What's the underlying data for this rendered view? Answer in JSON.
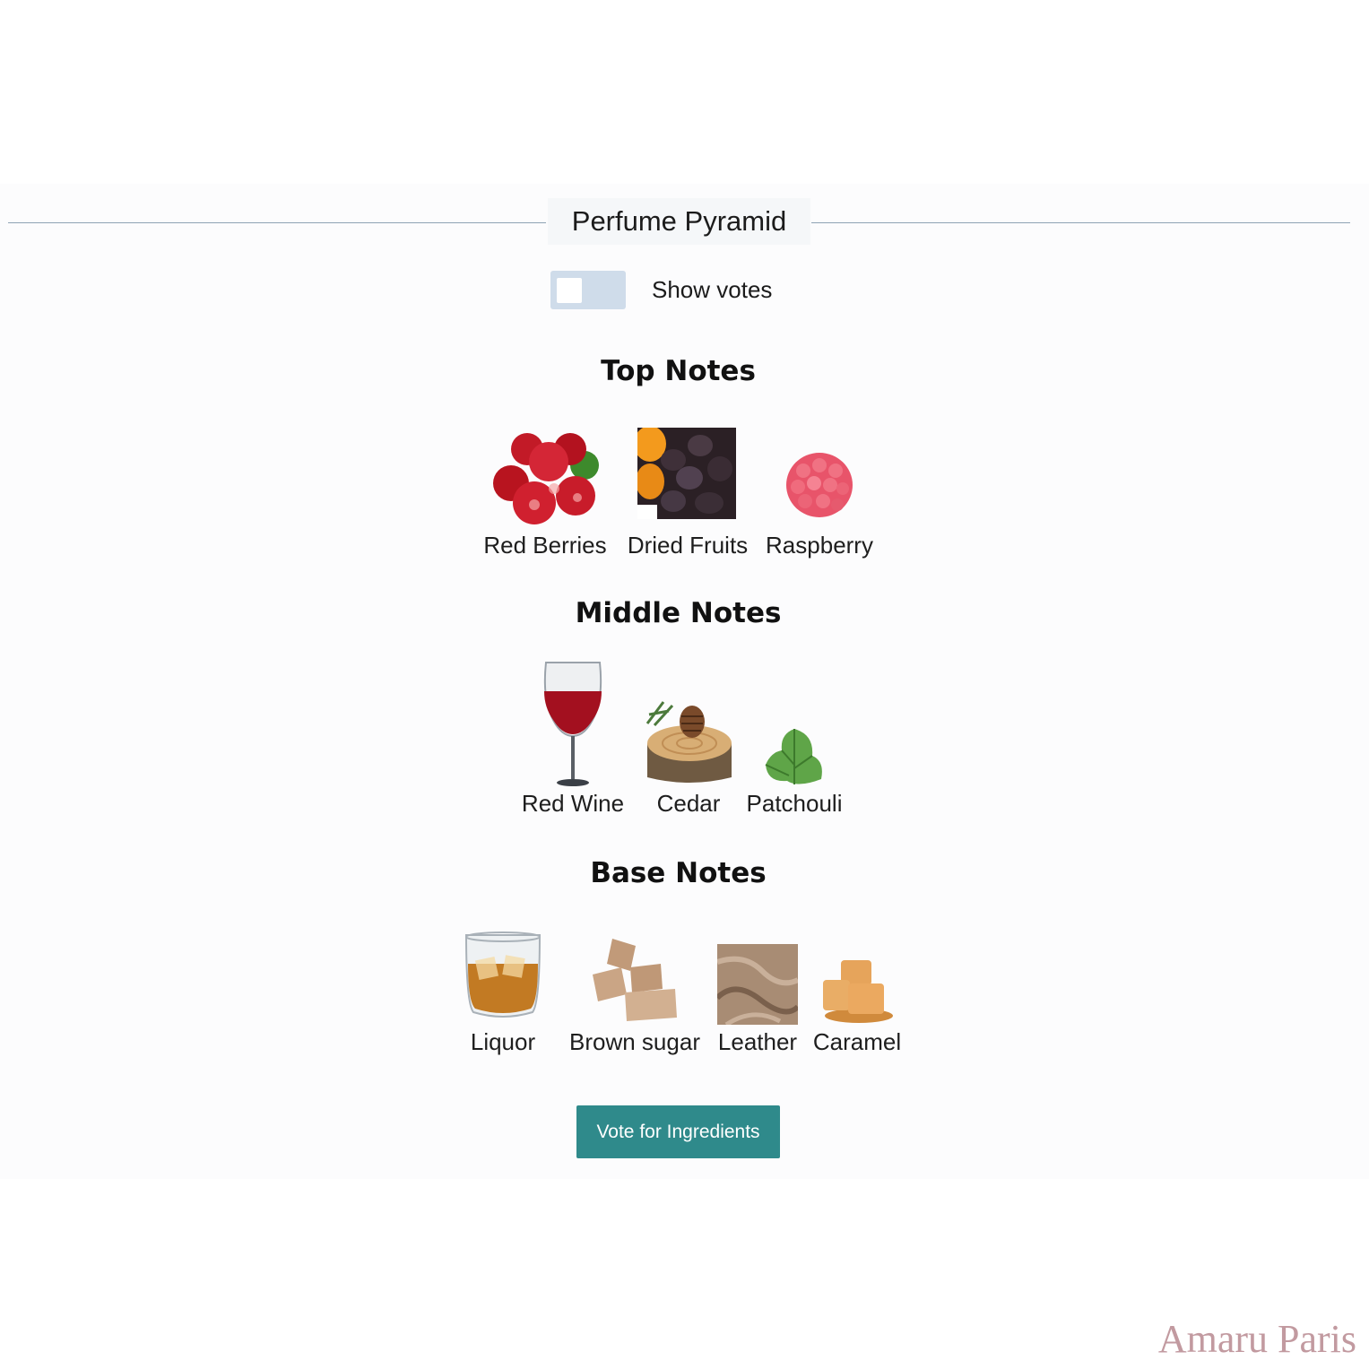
{
  "title": "Perfume Pyramid",
  "toggle": {
    "label": "Show votes",
    "on": false
  },
  "sections": {
    "top": {
      "title": "Top Notes",
      "notes": [
        {
          "label": "Red Berries",
          "icon": "red-berries-icon"
        },
        {
          "label": "Dried Fruits",
          "icon": "dried-fruits-icon"
        },
        {
          "label": "Raspberry",
          "icon": "raspberry-icon"
        }
      ]
    },
    "middle": {
      "title": "Middle Notes",
      "notes": [
        {
          "label": "Red Wine",
          "icon": "red-wine-icon"
        },
        {
          "label": "Cedar",
          "icon": "cedar-icon"
        },
        {
          "label": "Patchouli",
          "icon": "patchouli-icon"
        }
      ]
    },
    "base": {
      "title": "Base Notes",
      "notes": [
        {
          "label": "Liquor",
          "icon": "liquor-icon"
        },
        {
          "label": "Brown sugar",
          "icon": "brown-sugar-icon"
        },
        {
          "label": "Leather",
          "icon": "leather-icon"
        },
        {
          "label": "Caramel",
          "icon": "caramel-icon"
        }
      ]
    }
  },
  "vote_button": "Vote for Ingredients",
  "watermark": "Amaru Paris",
  "colors": {
    "accent": "#2f8a8b",
    "toggle_track": "#cfdcea",
    "divider": "#8fa3b4",
    "watermark": "#c29aa0"
  }
}
